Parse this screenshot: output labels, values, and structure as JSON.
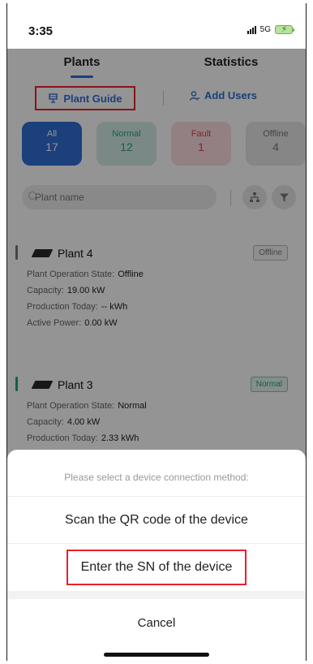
{
  "status_bar": {
    "time": "3:35",
    "network": "5G"
  },
  "tabs": [
    {
      "label": "Plants",
      "active": true
    },
    {
      "label": "Statistics",
      "active": false
    }
  ],
  "actions": {
    "plant_guide": "Plant Guide",
    "add_users": "Add Users"
  },
  "filters": [
    {
      "label": "All",
      "count": "17"
    },
    {
      "label": "Normal",
      "count": "12"
    },
    {
      "label": "Fault",
      "count": "1"
    },
    {
      "label": "Offline",
      "count": "4"
    }
  ],
  "search": {
    "placeholder": "Plant name"
  },
  "plants": [
    {
      "name": "Plant 4",
      "badge": "Offline",
      "state_label": "Plant Operation State:",
      "state_value": "Offline",
      "capacity_label": "Capacity:",
      "capacity_value": "19.00 kW",
      "production_label": "Production Today:",
      "production_value": "-- kWh",
      "power_label": "Active Power:",
      "power_value": "0.00 kW"
    },
    {
      "name": "Plant 3",
      "badge": "Normal",
      "state_label": "Plant Operation State:",
      "state_value": "Normal",
      "capacity_label": "Capacity:",
      "capacity_value": "4.00 kW",
      "production_label": "Production Today:",
      "production_value": "2.33 kWh"
    }
  ],
  "sheet": {
    "title": "Please select a device connection method:",
    "option_scan": "Scan the QR code of the device",
    "option_sn": "Enter the SN of the device",
    "cancel": "Cancel"
  },
  "colors": {
    "accent": "#2f6fd6",
    "highlight": "#e8212c",
    "normal": "#2d9c88",
    "fault": "#e2424f"
  }
}
